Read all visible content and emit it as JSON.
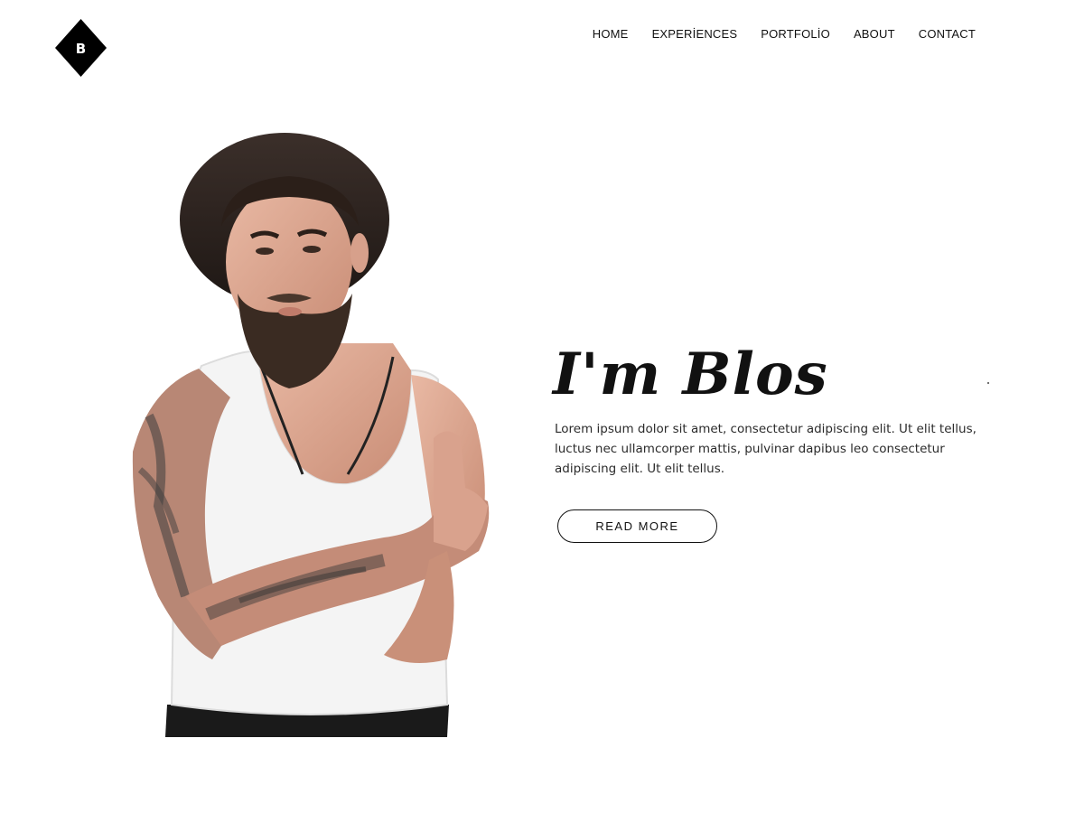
{
  "brand": {
    "logo_letter": "B"
  },
  "nav": {
    "items": [
      {
        "label": "HOME",
        "name": "home"
      },
      {
        "label": "EXPERİENCES",
        "name": "experiences"
      },
      {
        "label": "PORTFOLİO",
        "name": "portfolio"
      },
      {
        "label": "ABOUT",
        "name": "about"
      },
      {
        "label": "CONTACT",
        "name": "contact"
      }
    ]
  },
  "hero": {
    "title": "I'm Blos",
    "description": "Lorem ipsum dolor sit amet, consectetur adipiscing elit. Ut elit tellus, luctus nec ullamcorper mattis, pulvinar dapibus leo consectetur adipiscing elit. Ut elit tellus.",
    "button_label": "READ MORE"
  },
  "colors": {
    "background": "#ffffff",
    "text": "#111111",
    "accent": "#000000"
  }
}
